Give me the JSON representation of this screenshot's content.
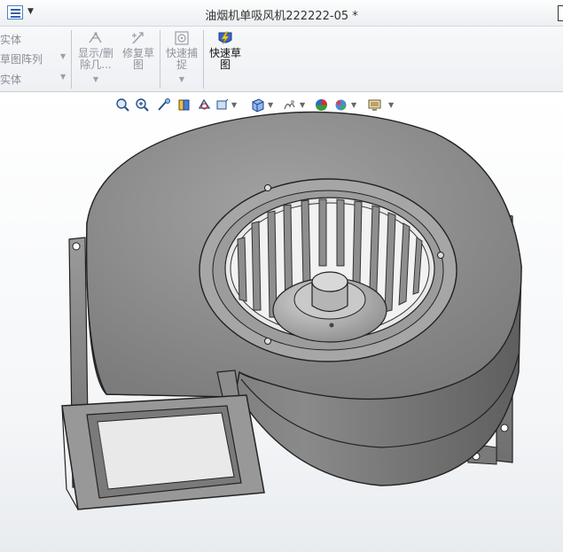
{
  "window": {
    "title": "油烟机单吸风机222222-05 *"
  },
  "ribbon": {
    "left_items": [
      {
        "label": "实体"
      },
      {
        "label": "草图阵列"
      },
      {
        "label": "实体"
      }
    ],
    "show_hide_label": "显示/删\n除几...",
    "repair_sketch_label": "修复草\n图",
    "quick_snap_label": "快速捕\n捉",
    "rapid_sketch_label": "快速草\n图"
  },
  "view_toolbar": {
    "icons": [
      "zoom-to-fit-icon",
      "zoom-to-area-icon",
      "previous-view-icon",
      "section-view-icon",
      "view-orientation-icon",
      "display-style-icon",
      "hide-show-items-icon",
      "edit-appearance-icon",
      "apply-scene-icon",
      "view-settings-icon"
    ]
  },
  "colors": {
    "model_body": "#8c8c8c",
    "model_dark": "#555555",
    "model_light": "#bdbdbd",
    "viewport_bg": "#ffffff",
    "accent_blue": "#2f63b5"
  }
}
